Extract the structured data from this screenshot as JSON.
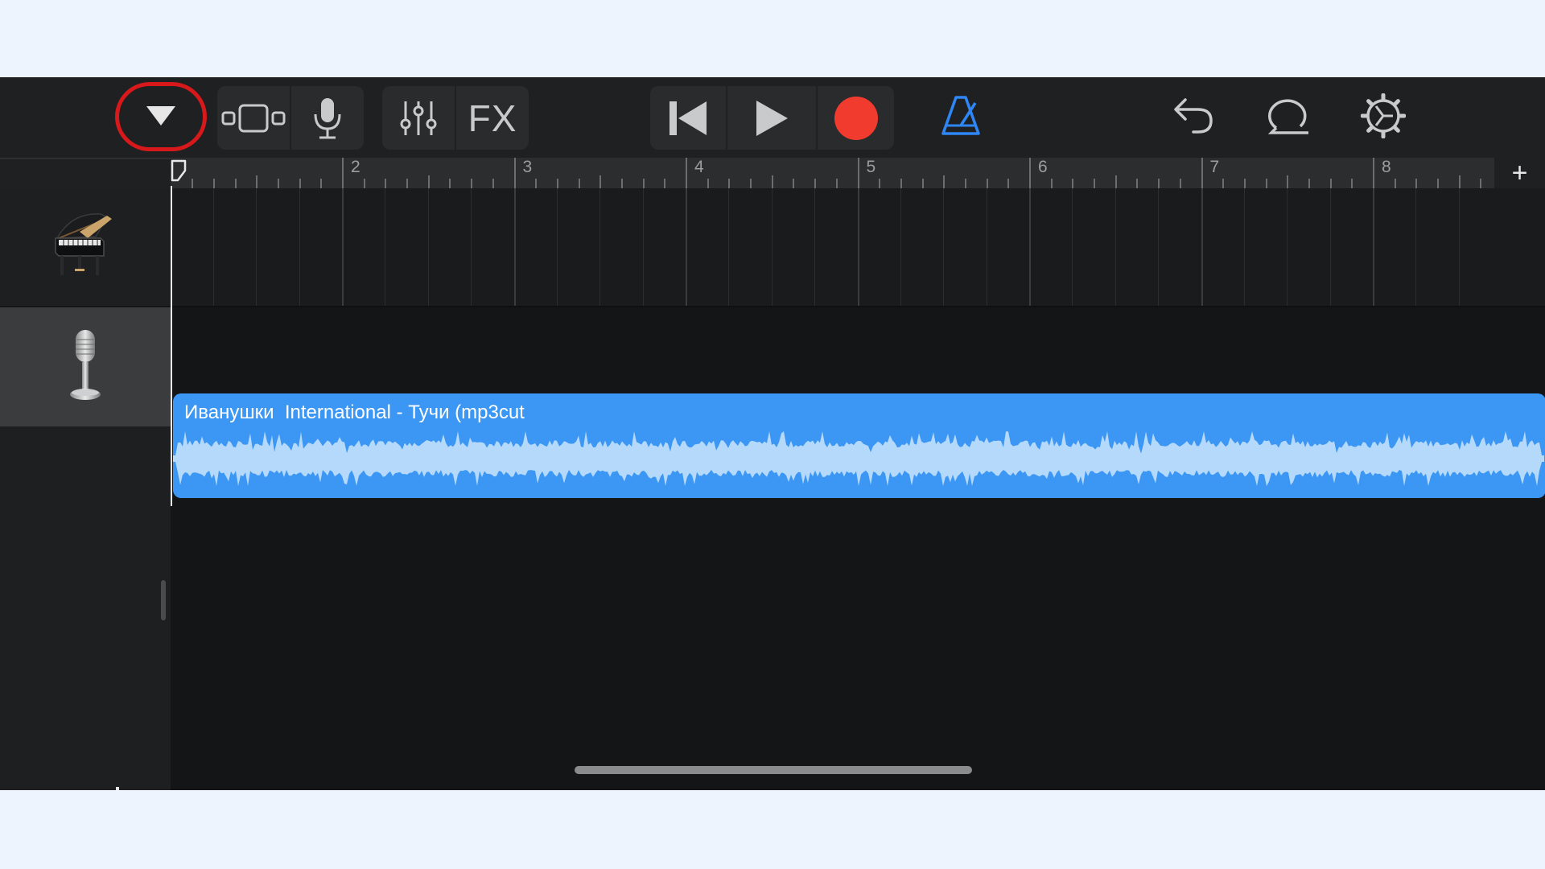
{
  "toolbar": {
    "tracks_view_icon": "triangle-down-icon",
    "browser_icon": "track-view-icon",
    "mic_icon": "microphone-icon",
    "mixer_icon": "sliders-icon",
    "fx_label": "FX",
    "rewind_icon": "skip-back-icon",
    "play_icon": "play-icon",
    "record_icon": "record-icon",
    "metronome_icon": "metronome-icon",
    "undo_icon": "undo-icon",
    "loop_icon": "loop-browser-icon",
    "settings_icon": "gear-icon",
    "record_color": "#f23b2f",
    "metronome_color": "#2f86f6",
    "highlight_color": "#d7191c"
  },
  "ruler": {
    "bars": [
      "2",
      "3",
      "4",
      "5",
      "6",
      "7",
      "8"
    ],
    "add_label": "+"
  },
  "tracks": [
    {
      "instrument": "piano-icon"
    },
    {
      "instrument": "microphone-icon"
    }
  ],
  "region": {
    "title": "Иванушки  International - Тучи (mp3cut",
    "color": "#3b97f3",
    "wave_color": "#b5d9fb"
  },
  "add_track_icon": "plus-icon"
}
